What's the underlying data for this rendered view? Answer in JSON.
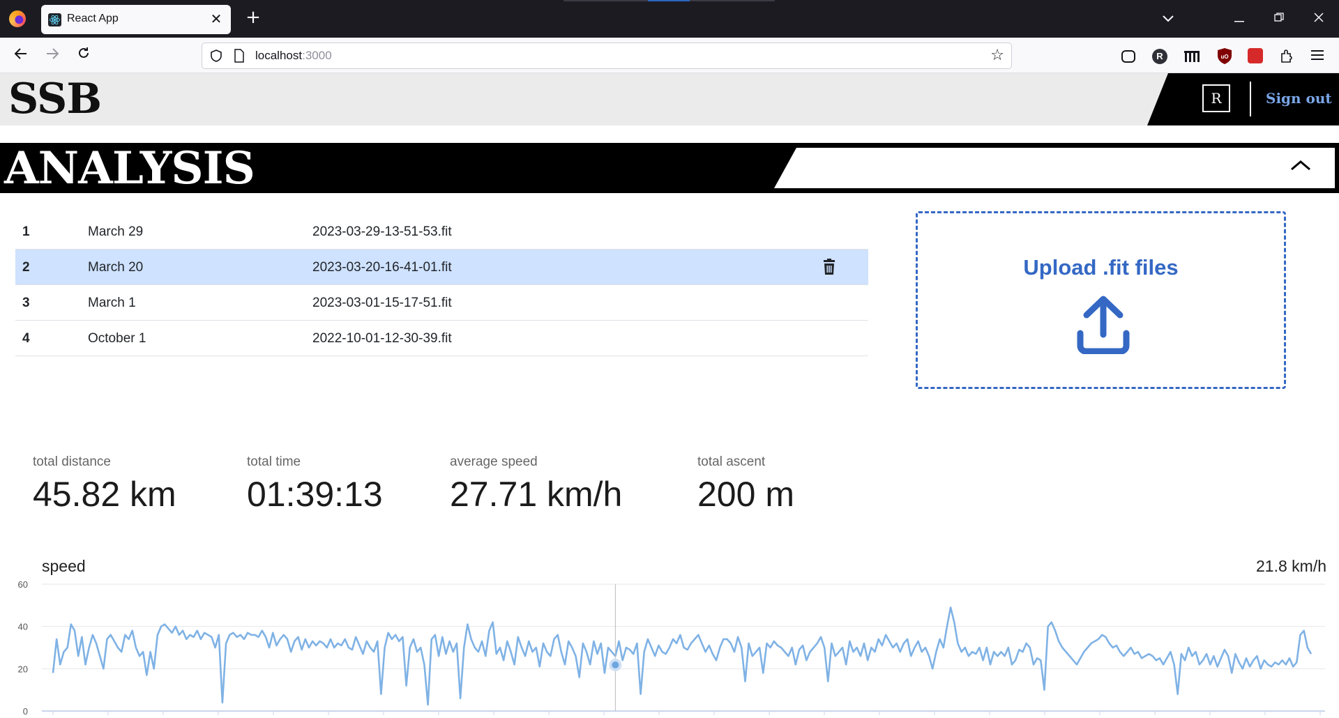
{
  "browser": {
    "tab_title": "React App",
    "url_host": "localhost",
    "url_port": ":3000"
  },
  "app": {
    "brand": "SSB",
    "avatar_initial": "R",
    "signout_label": "Sign out",
    "section_title": "ANALYSIS"
  },
  "files": [
    {
      "num": "1",
      "date": "March 29",
      "filename": "2023-03-29-13-51-53.fit",
      "selected": false
    },
    {
      "num": "2",
      "date": "March 20",
      "filename": "2023-03-20-16-41-01.fit",
      "selected": true
    },
    {
      "num": "3",
      "date": "March 1",
      "filename": "2023-03-01-15-17-51.fit",
      "selected": false
    },
    {
      "num": "4",
      "date": "October 1",
      "filename": "2022-10-01-12-30-39.fit",
      "selected": false
    }
  ],
  "upload": {
    "label": "Upload .fit files",
    "icon": "upload-icon"
  },
  "stats": [
    {
      "label": "total distance",
      "value": "45.82 km"
    },
    {
      "label": "total time",
      "value": "01:39:13"
    },
    {
      "label": "average speed",
      "value": "27.71 km/h"
    },
    {
      "label": "total ascent",
      "value": "200 m"
    }
  ],
  "colors": {
    "accent": "#3468c4",
    "selected_row": "#cfe2ff",
    "line": "#7fb2e5",
    "signout": "#7aa6e8"
  },
  "chart_data": {
    "type": "line",
    "title": "speed",
    "readout": "21.8 km/h",
    "xlabel": "",
    "ylabel": "",
    "ylim": [
      0,
      60
    ],
    "yticks": [
      "60",
      "40",
      "20",
      "0"
    ],
    "grid": true,
    "cursor_value": 21.8,
    "series": [
      {
        "values": [
          18,
          34,
          22,
          28,
          30,
          41,
          38,
          26,
          35,
          22,
          30,
          36,
          32,
          26,
          20,
          34,
          36,
          33,
          30,
          28,
          36,
          34,
          38,
          30,
          26,
          28,
          17,
          28,
          20,
          36,
          40,
          41,
          39,
          37,
          40,
          36,
          38,
          34,
          36,
          35,
          38,
          34,
          37,
          36,
          35,
          30,
          36,
          4,
          32,
          36,
          37,
          35,
          36,
          34,
          37,
          36,
          36,
          35,
          38,
          35,
          30,
          37,
          31,
          34,
          36,
          34,
          28,
          33,
          35,
          29,
          34,
          30,
          33,
          31,
          33,
          32,
          30,
          34,
          30,
          32,
          31,
          34,
          30,
          29,
          35,
          31,
          27,
          33,
          30,
          28,
          33,
          8,
          30,
          37,
          34,
          36,
          33,
          35,
          12,
          30,
          34,
          28,
          30,
          22,
          3,
          34,
          36,
          26,
          35,
          27,
          33,
          28,
          32,
          6,
          30,
          41,
          34,
          30,
          28,
          33,
          26,
          38,
          42,
          27,
          30,
          24,
          33,
          28,
          22,
          35,
          30,
          26,
          33,
          28,
          30,
          21,
          32,
          28,
          26,
          34,
          36,
          28,
          22,
          33,
          30,
          26,
          16,
          32,
          28,
          22,
          33,
          27,
          32,
          18,
          30,
          28,
          26,
          33,
          24,
          30,
          29,
          27,
          32,
          8,
          28,
          34,
          30,
          26,
          31,
          28,
          27,
          30,
          34,
          32,
          36,
          30,
          29,
          32,
          34,
          36,
          32,
          28,
          31,
          27,
          24,
          30,
          34,
          34,
          32,
          28,
          35,
          30,
          14,
          32,
          26,
          28,
          30,
          18,
          32,
          30,
          33,
          31,
          30,
          28,
          26,
          30,
          22,
          29,
          31,
          24,
          28,
          30,
          32,
          35,
          30,
          14,
          32,
          26,
          28,
          30,
          22,
          33,
          28,
          30,
          26,
          32,
          24,
          30,
          28,
          34,
          31,
          36,
          33,
          30,
          32,
          28,
          32,
          34,
          26,
          30,
          33,
          28,
          30,
          26,
          20,
          28,
          34,
          30,
          40,
          49,
          42,
          32,
          28,
          30,
          26,
          28,
          27,
          30,
          24,
          30,
          22,
          28,
          26,
          28,
          26,
          30,
          22,
          24,
          29,
          28,
          32,
          30,
          22,
          25,
          24,
          10,
          40,
          42,
          38,
          33,
          30,
          28,
          26,
          24,
          22,
          25,
          28,
          30,
          32,
          33,
          34,
          36,
          35,
          32,
          30,
          31,
          28,
          26,
          28,
          30,
          27,
          28,
          25,
          26,
          27,
          26,
          24,
          25,
          22,
          25,
          28,
          22,
          8,
          27,
          24,
          30,
          26,
          28,
          22,
          24,
          27,
          22,
          26,
          21,
          25,
          29,
          26,
          18,
          27,
          23,
          20,
          25,
          21,
          24,
          26,
          20,
          24,
          22,
          21,
          23,
          22,
          24,
          22,
          25,
          21,
          23,
          36,
          38,
          30,
          27
        ]
      }
    ]
  }
}
